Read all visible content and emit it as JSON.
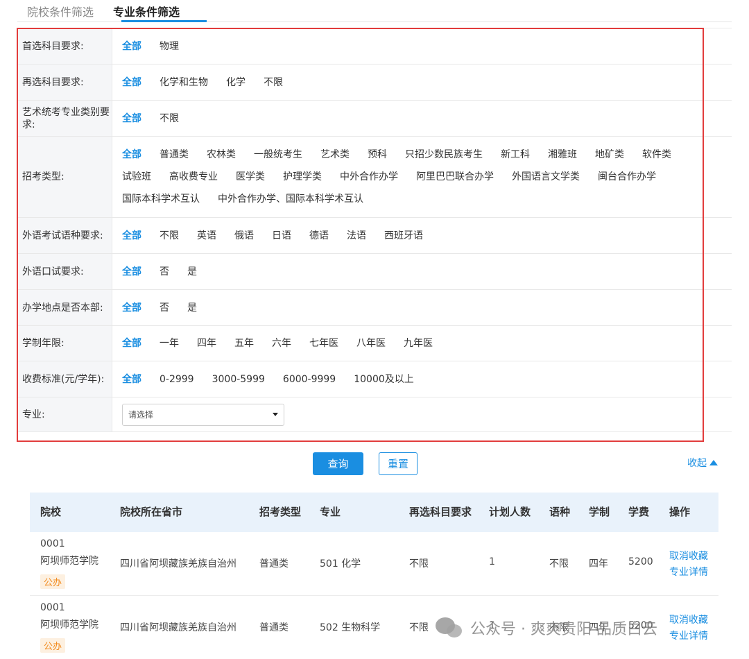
{
  "tabs": [
    {
      "label": "院校条件筛选"
    },
    {
      "label": "专业条件筛选"
    }
  ],
  "filters": [
    {
      "label": "首选科目要求:",
      "options": [
        "全部",
        "物理"
      ]
    },
    {
      "label": "再选科目要求:",
      "options": [
        "全部",
        "化学和生物",
        "化学",
        "不限"
      ]
    },
    {
      "label": "艺术统考专业类别要求:",
      "options": [
        "全部",
        "不限"
      ]
    },
    {
      "label": "招考类型:",
      "options": [
        "全部",
        "普通类",
        "农林类",
        "一般统考生",
        "艺术类",
        "预科",
        "只招少数民族考生",
        "新工科",
        "湘雅班",
        "地矿类",
        "软件类",
        "试验班",
        "高收费专业",
        "医学类",
        "护理学类",
        "中外合作办学",
        "阿里巴巴联合办学",
        "外国语言文学类",
        "闽台合作办学",
        "国际本科学术互认",
        "中外合作办学、国际本科学术互认"
      ]
    },
    {
      "label": "外语考试语种要求:",
      "options": [
        "全部",
        "不限",
        "英语",
        "俄语",
        "日语",
        "德语",
        "法语",
        "西班牙语"
      ]
    },
    {
      "label": "外语口试要求:",
      "options": [
        "全部",
        "否",
        "是"
      ]
    },
    {
      "label": "办学地点是否本部:",
      "options": [
        "全部",
        "否",
        "是"
      ]
    },
    {
      "label": "学制年限:",
      "options": [
        "全部",
        "一年",
        "四年",
        "五年",
        "六年",
        "七年医",
        "八年医",
        "九年医"
      ]
    },
    {
      "label": "收费标准(元/学年):",
      "options": [
        "全部",
        "0-2999",
        "3000-5999",
        "6000-9999",
        "10000及以上"
      ]
    }
  ],
  "major": {
    "label": "专业:",
    "placeholder": "请选择"
  },
  "actions": {
    "query": "查询",
    "reset": "重置",
    "collapse": "收起"
  },
  "table": {
    "headers": [
      "院校",
      "院校所在省市",
      "招考类型",
      "专业",
      "再选科目要求",
      "计划人数",
      "语种",
      "学制",
      "学费",
      "操作"
    ],
    "rows": [
      {
        "code": "0001",
        "name": "阿坝师范学院",
        "badge": "公办",
        "province": "四川省阿坝藏族羌族自治州",
        "type": "普通类",
        "major": "501 化学",
        "subject": "不限",
        "plan": "1",
        "lang": "不限",
        "years": "四年",
        "fee": "5200",
        "op1": "取消收藏",
        "op2": "专业详情"
      },
      {
        "code": "0001",
        "name": "阿坝师范学院",
        "badge": "公办",
        "province": "四川省阿坝藏族羌族自治州",
        "type": "普通类",
        "major": "502 生物科学",
        "subject": "不限",
        "plan": "1",
        "lang": "不限",
        "years": "四年",
        "fee": "5200",
        "op1": "取消收藏",
        "op2": "专业详情"
      }
    ]
  },
  "watermark": "公众号 · 爽爽贵阳 品质白云",
  "colors": {
    "accent": "#1a8ee1",
    "highlight_border": "#e23c3c",
    "badge": "#f28a1c"
  }
}
